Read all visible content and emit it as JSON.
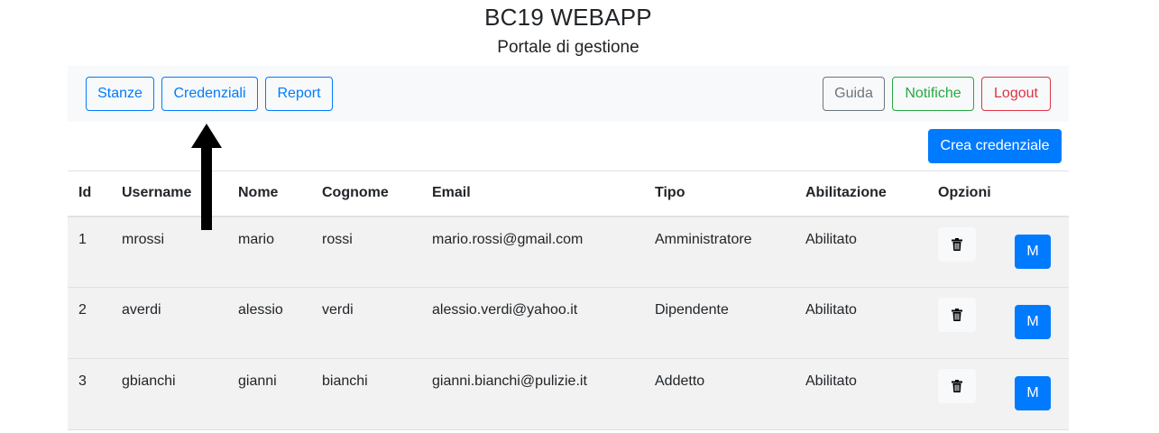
{
  "header": {
    "title": "BC19 WEBAPP",
    "subtitle": "Portale di gestione"
  },
  "nav": {
    "left": [
      "Stanze",
      "Credenziali",
      "Report"
    ],
    "right": [
      "Guida",
      "Notifiche",
      "Logout"
    ]
  },
  "actions": {
    "create_label": "Crea credenziale"
  },
  "table": {
    "headers": [
      "Id",
      "Username",
      "Nome",
      "Cognome",
      "Email",
      "Tipo",
      "Abilitazione",
      "Opzioni"
    ],
    "rows": [
      [
        "1",
        "mrossi",
        "mario",
        "rossi",
        "mario.rossi@gmail.com",
        "Amministratore",
        "Abilitato"
      ],
      [
        "2",
        "averdi",
        "alessio",
        "verdi",
        "alessio.verdi@yahoo.it",
        "Dipendente",
        "Abilitato"
      ],
      [
        "3",
        "gbianchi",
        "gianni",
        "bianchi",
        "gianni.bianchi@pulizie.it",
        "Addetto",
        "Abilitato"
      ]
    ],
    "modify_label": "M"
  },
  "colors": {
    "primary": "#007bff",
    "secondary": "#6c757d",
    "success": "#28a745",
    "danger": "#dc3545",
    "row_bg": "#f2f2f2"
  },
  "icons": {
    "delete": "trash-icon",
    "annotation": "arrow-up-icon"
  }
}
